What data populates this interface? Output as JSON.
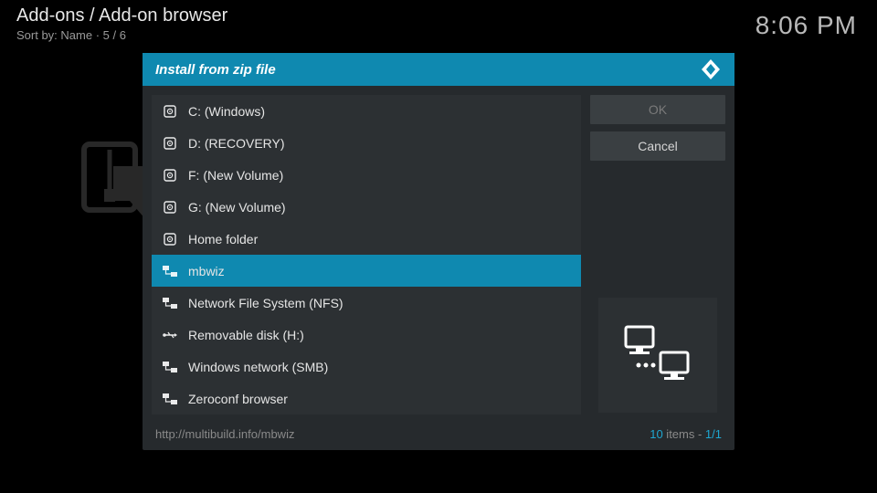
{
  "header": {
    "breadcrumb": "Add-ons / Add-on browser",
    "sort_label": "Sort by: Name  ·  5 / 6",
    "clock": "8:06 PM"
  },
  "dialog": {
    "title": "Install from zip file",
    "ok": "OK",
    "cancel": "Cancel",
    "path": "http://multibuild.info/mbwiz",
    "count_num": "10",
    "count_text": " items - ",
    "page": "1/1",
    "items": [
      {
        "label": "C: (Windows)",
        "icon": "disk",
        "selected": false
      },
      {
        "label": "D: (RECOVERY)",
        "icon": "disk",
        "selected": false
      },
      {
        "label": "F: (New Volume)",
        "icon": "disk",
        "selected": false
      },
      {
        "label": "G: (New Volume)",
        "icon": "disk",
        "selected": false
      },
      {
        "label": "Home folder",
        "icon": "disk",
        "selected": false
      },
      {
        "label": "mbwiz",
        "icon": "network",
        "selected": true
      },
      {
        "label": "Network File System (NFS)",
        "icon": "network",
        "selected": false
      },
      {
        "label": "Removable disk (H:)",
        "icon": "usb",
        "selected": false
      },
      {
        "label": "Windows network (SMB)",
        "icon": "network",
        "selected": false
      },
      {
        "label": "Zeroconf browser",
        "icon": "network",
        "selected": false
      }
    ]
  }
}
